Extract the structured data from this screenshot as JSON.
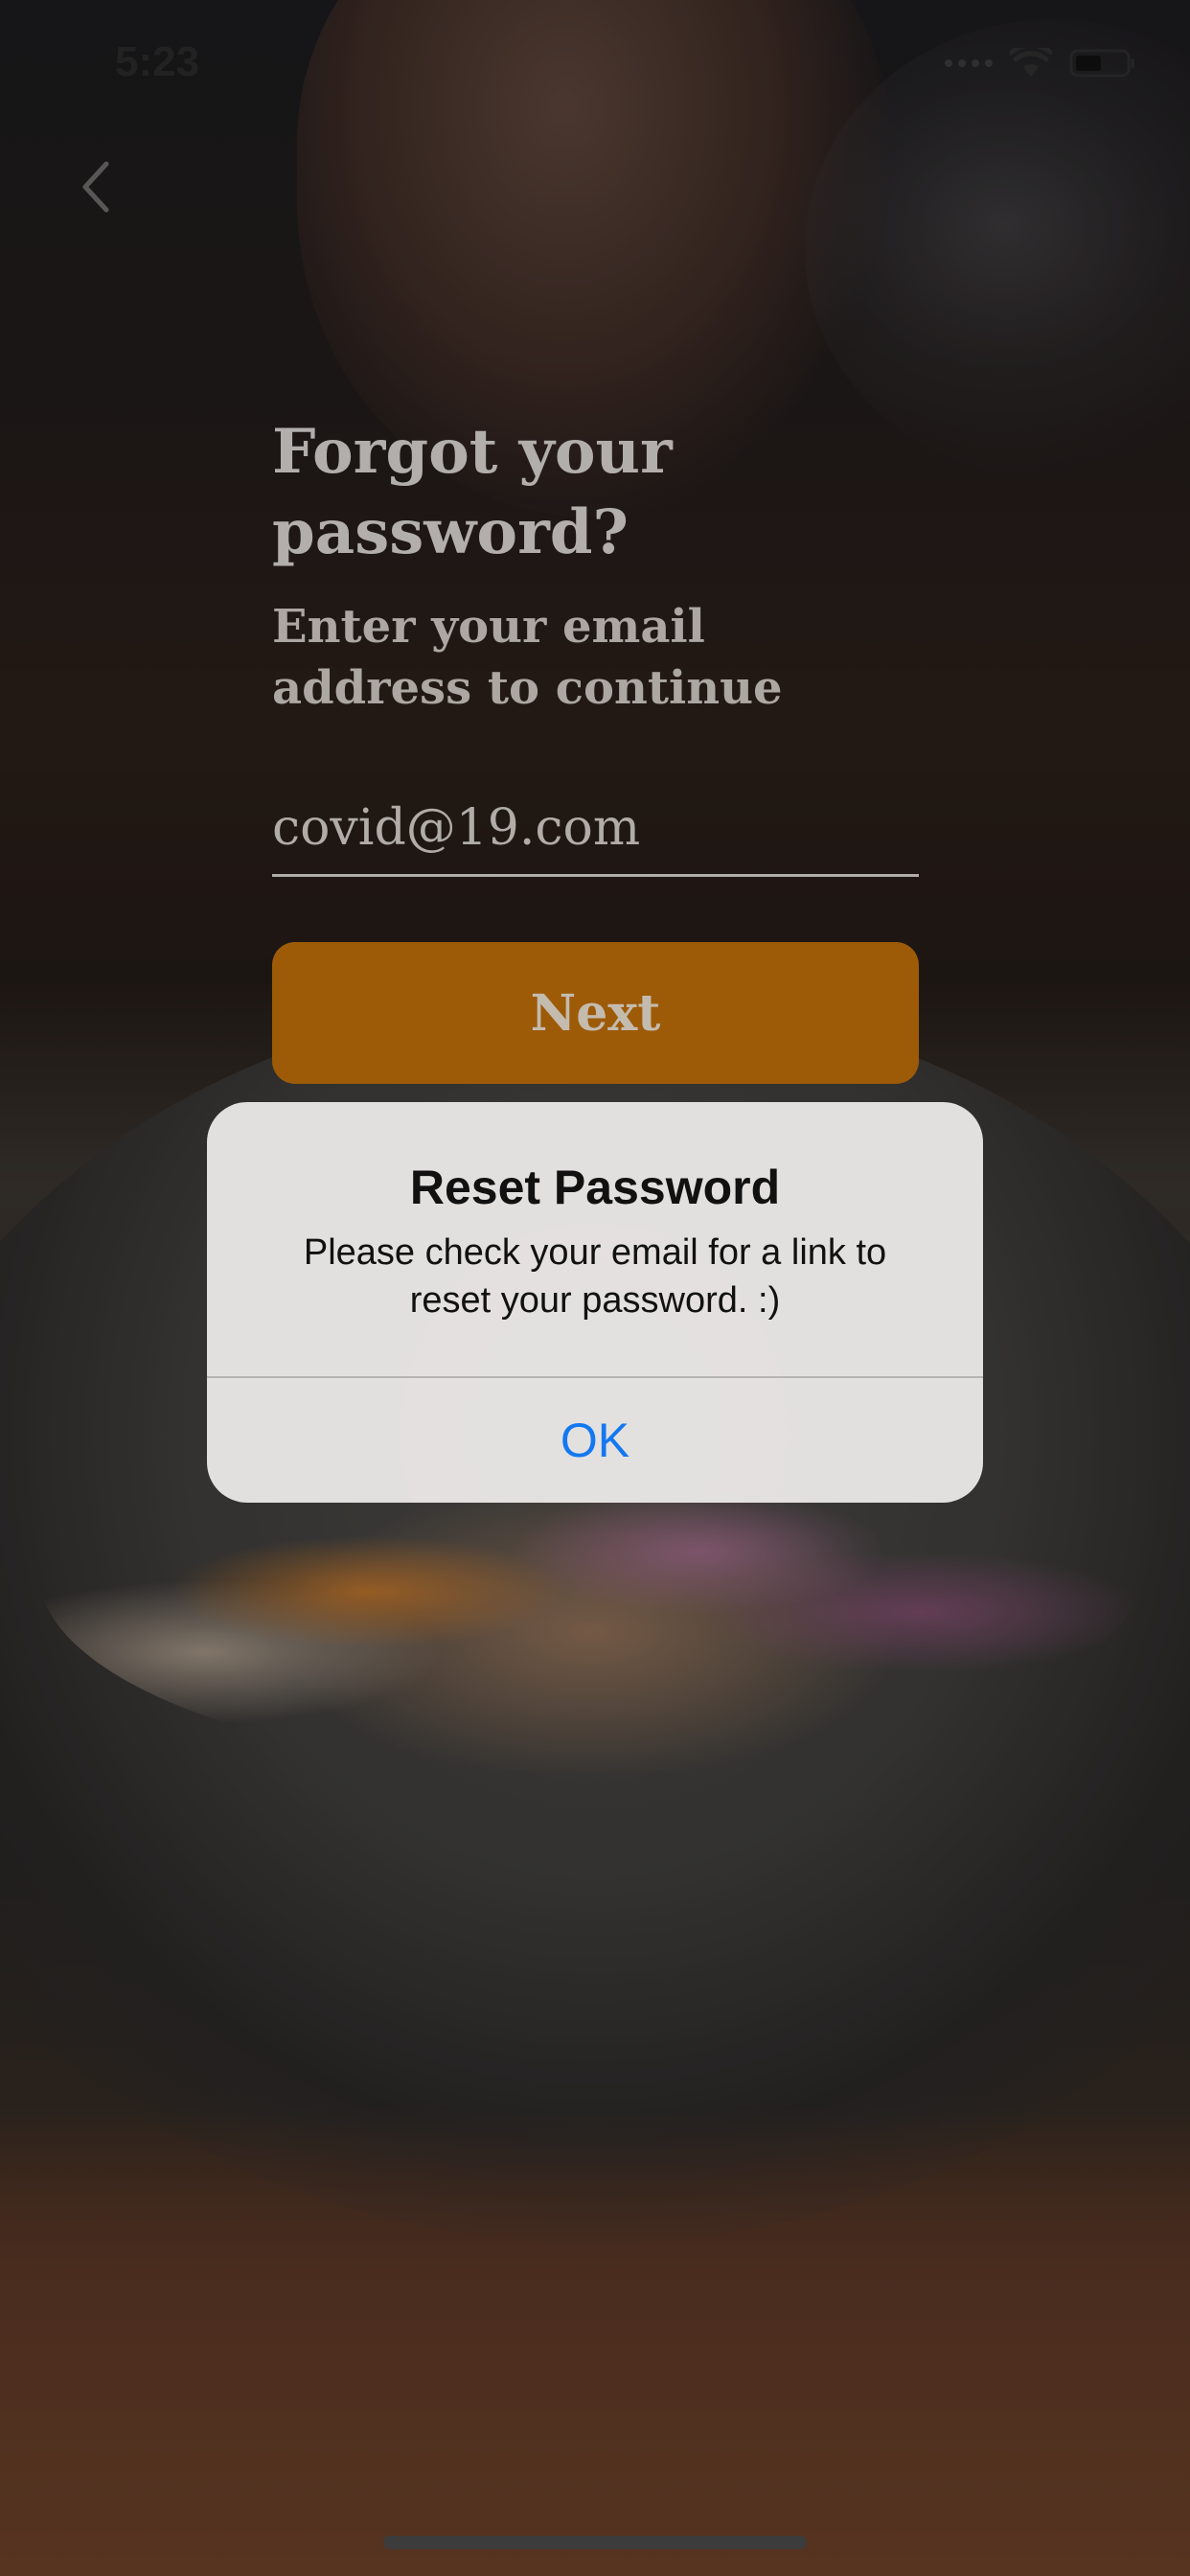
{
  "status_bar": {
    "time": "5:23"
  },
  "icons": {
    "back": "chevron-left-icon",
    "signal": "signal-dots-icon",
    "wifi": "wifi-icon",
    "battery": "battery-icon"
  },
  "screen": {
    "title": "Forgot your password?",
    "subtitle": "Enter your email address to continue",
    "email_value": "covid@19.com",
    "next_label": "Next"
  },
  "alert": {
    "title": "Reset Password",
    "message": "Please check your email for a link to reset your password. :)",
    "ok_label": "OK"
  },
  "colors": {
    "accent": "#c06f0a",
    "link_blue": "#1478f0"
  }
}
